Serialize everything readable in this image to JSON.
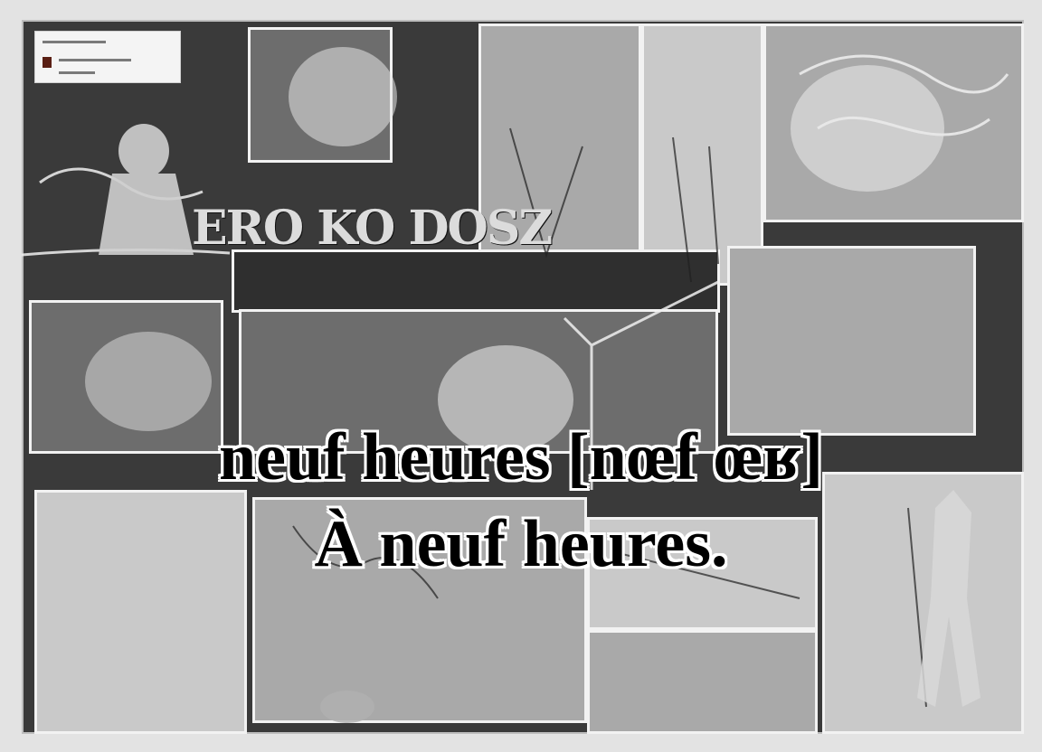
{
  "poster": {
    "title_text": "ERO KO DOSZ",
    "label_card": {
      "lines": [
        "3 VO 00000000",
        "0000000",
        "00001"
      ]
    }
  },
  "subtitles": {
    "line1": "neuf heures  [nœf œʁ]",
    "line2": "À neuf heures."
  },
  "icons": {
    "figure_left": "creature-figure-icon",
    "figure_right": "skeleton-figure-icon"
  }
}
